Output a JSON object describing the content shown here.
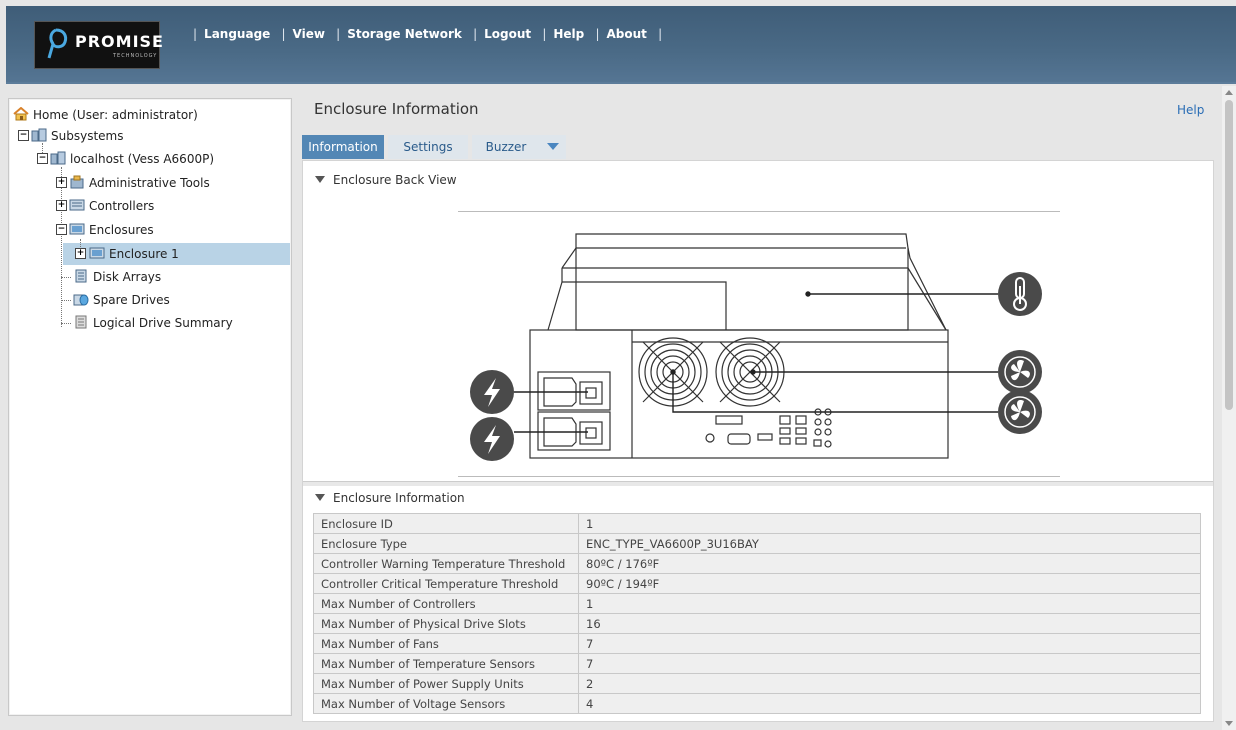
{
  "header": {
    "logo_text": "PROMISE",
    "logo_subtext": "TECHNOLOGY",
    "nav": [
      "Language",
      "View",
      "Storage Network",
      "Logout",
      "Help",
      "About"
    ]
  },
  "tree": {
    "home": "Home (User: administrator)",
    "subsystems": "Subsystems",
    "localhost": "localhost (Vess A6600P)",
    "admin_tools": "Administrative Tools",
    "controllers": "Controllers",
    "enclosures": "Enclosures",
    "enclosure1": "Enclosure 1",
    "disk_arrays": "Disk Arrays",
    "spare_drives": "Spare Drives",
    "logical_drive_summary": "Logical Drive Summary"
  },
  "main": {
    "title": "Enclosure Information",
    "help": "Help",
    "tabs": [
      {
        "label": "Information"
      },
      {
        "label": "Settings"
      },
      {
        "label": "Buzzer"
      }
    ],
    "back_view_header": "Enclosure Back View",
    "info_header": "Enclosure Information",
    "rows": [
      {
        "key": "Enclosure ID",
        "value": "1"
      },
      {
        "key": "Enclosure Type",
        "value": "ENC_TYPE_VA6600P_3U16BAY"
      },
      {
        "key": "Controller Warning Temperature Threshold",
        "value": "80ºC / 176ºF"
      },
      {
        "key": "Controller Critical Temperature Threshold",
        "value": "90ºC / 194ºF"
      },
      {
        "key": "Max Number of Controllers",
        "value": "1"
      },
      {
        "key": "Max Number of Physical Drive Slots",
        "value": "16"
      },
      {
        "key": "Max Number of Fans",
        "value": "7"
      },
      {
        "key": "Max Number of Temperature Sensors",
        "value": "7"
      },
      {
        "key": "Max Number of Power Supply Units",
        "value": "2"
      },
      {
        "key": "Max Number of Voltage Sensors",
        "value": "4"
      }
    ]
  },
  "colors": {
    "header_bg": "#4a6a86",
    "active_tab": "#5387b5",
    "selection": "#b9d3e6",
    "icon_circle": "#4a4a4a"
  }
}
